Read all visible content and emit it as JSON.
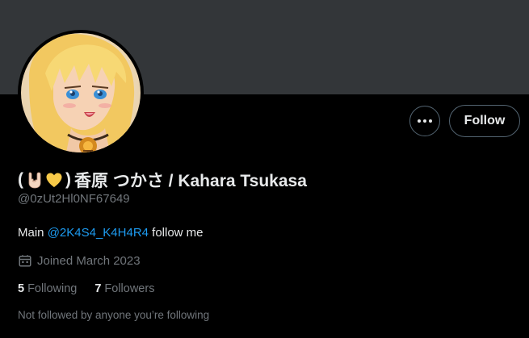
{
  "profile": {
    "display_name_open": "(",
    "display_name_close": ")",
    "display_name_text": "香原 つかさ / Kahara Tsukasa",
    "handle": "@0zUt2Hl0NF67649",
    "bio_prefix": "Main ",
    "bio_link": "@2K4S4_K4H4R4",
    "bio_suffix": " follow me",
    "joined": "Joined March 2023",
    "following_count": "5",
    "following_label": "Following",
    "followers_count": "7",
    "followers_label": "Followers",
    "not_followed_text": "Not followed by anyone you’re following"
  },
  "actions": {
    "more_label": "•••",
    "follow_label": "Follow"
  },
  "icons": {
    "more": "more-icon",
    "calendar": "calendar-icon",
    "rock_hand": "rock-hand-emoji",
    "heart": "yellow-heart-emoji"
  },
  "colors": {
    "background": "#000000",
    "banner": "#333639",
    "text_primary": "#e7e9ea",
    "text_secondary": "#71767b",
    "link": "#1d9bf0",
    "border": "#536471"
  }
}
